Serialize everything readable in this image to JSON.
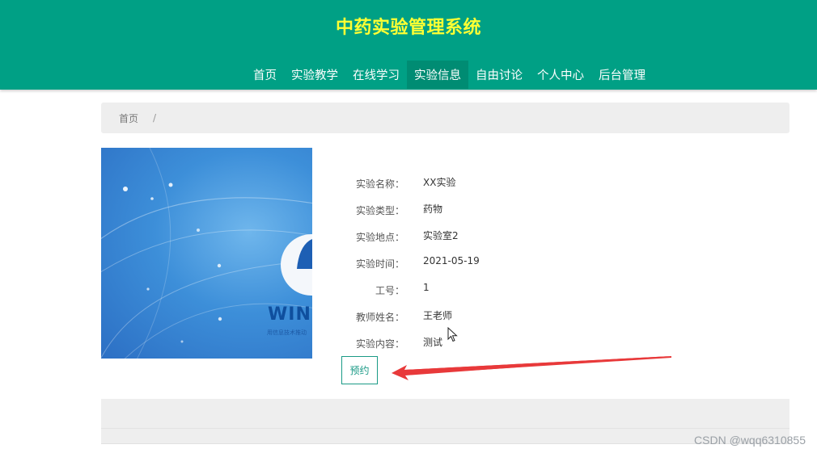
{
  "header": {
    "title": "中药实验管理系统",
    "nav": [
      {
        "label": "首页",
        "active": false
      },
      {
        "label": "实验教学",
        "active": false
      },
      {
        "label": "在线学习",
        "active": false
      },
      {
        "label": "实验信息",
        "active": true
      },
      {
        "label": "自由讨论",
        "active": false
      },
      {
        "label": "个人中心",
        "active": false
      },
      {
        "label": "后台管理",
        "active": false
      }
    ]
  },
  "breadcrumb": {
    "home": "首页",
    "separator": "/"
  },
  "poster": {
    "brand_text": "WINI",
    "slogan": "用信息技术推动"
  },
  "details": [
    {
      "label": "实验名称：",
      "value": "XX实验"
    },
    {
      "label": "实验类型：",
      "value": "药物"
    },
    {
      "label": "实验地点：",
      "value": "实验室2"
    },
    {
      "label": "实验时间：",
      "value": "2021-05-19"
    },
    {
      "label": "工号：",
      "value": "1"
    },
    {
      "label": "教师姓名：",
      "value": "王老师"
    },
    {
      "label": "实验内容：",
      "value": "测试"
    }
  ],
  "book_button": {
    "label": "预约"
  },
  "watermark": "CSDN @wqq6310855",
  "colors": {
    "header": "#00a085",
    "active_nav": "#008c73",
    "title": "#ffff33",
    "accent": "#1a9a86",
    "arrow": "#e8393a"
  }
}
